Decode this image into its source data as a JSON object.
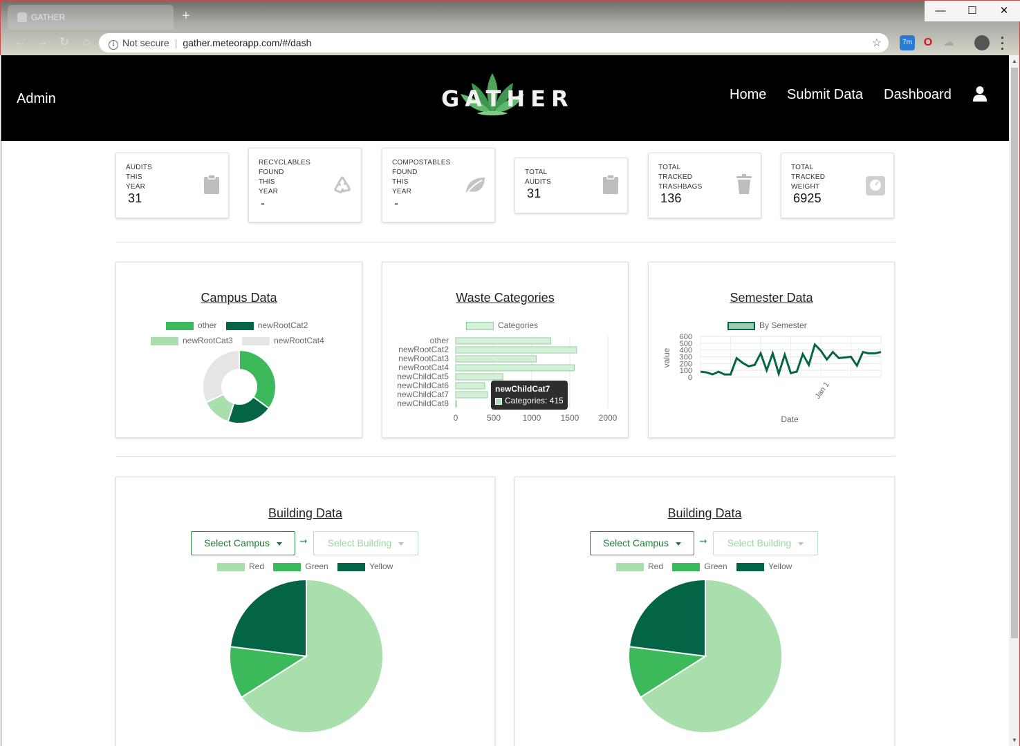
{
  "browser": {
    "tab_title": "GATHER",
    "security_label": "Not secure",
    "url": "gather.meteorapp.com/#/dash",
    "ext_badge": "7m"
  },
  "nav": {
    "user_label": "Admin",
    "logo_text": "GATHER",
    "links": [
      "Home",
      "Submit Data",
      "Dashboard"
    ]
  },
  "stats": [
    {
      "label": [
        "AUDITS",
        "THIS",
        "YEAR"
      ],
      "value": "31",
      "icon": "clipboard-icon"
    },
    {
      "label": [
        "RECYCLABLES",
        "FOUND",
        " THIS",
        "YEAR"
      ],
      "value": "-",
      "icon": "recycle-icon"
    },
    {
      "label": [
        "COMPOSTABLES",
        "FOUND",
        " THIS",
        "YEAR"
      ],
      "value": "-",
      "icon": "leaf-icon"
    },
    {
      "label": [
        "TOTAL",
        "AUDITS"
      ],
      "value": "31",
      "icon": "clipboard-icon"
    },
    {
      "label": [
        "TOTAL",
        "TRACKED",
        "TRASHBAGS"
      ],
      "value": "136",
      "icon": "trash-icon"
    },
    {
      "label": [
        "TOTAL",
        "TRACKED",
        "WEIGHT"
      ],
      "value": "6925",
      "icon": "scale-icon"
    }
  ],
  "colors": {
    "green": "#3cb95a",
    "dark_green": "#046546",
    "light_green": "#a9dfac",
    "grey": "#e5e5e5",
    "bar_fill": "#d5f0d9",
    "bar_stroke": "#8fd19c"
  },
  "campus": {
    "title": "Campus Data",
    "legend": [
      "other",
      "newRootCat2",
      "newRootCat3",
      "newRootCat4"
    ]
  },
  "waste": {
    "title": "Waste Categories",
    "legend": "Categories",
    "tooltip_title": "newChildCat7",
    "tooltip_value": "Categories: 415"
  },
  "semester": {
    "title": "Semester Data",
    "legend": "By Semester",
    "ylabel": "value",
    "xlabel": "Date",
    "x_tick": "Jan 1"
  },
  "building": {
    "title": "Building Data",
    "select_campus": "Select Campus",
    "select_building": "Select Building",
    "legend": [
      "Red",
      "Green",
      "Yellow"
    ]
  },
  "chart_data": [
    {
      "type": "pie",
      "title": "Campus Data",
      "categories": [
        "other",
        "newRootCat2",
        "newRootCat3",
        "newRootCat4"
      ],
      "values": [
        35,
        20,
        13,
        32
      ],
      "donut": true
    },
    {
      "type": "bar",
      "orientation": "horizontal",
      "title": "Waste Categories",
      "categories": [
        "other",
        "newRootCat2",
        "newRootCat3",
        "newRootCat4",
        "newChildCat5",
        "newChildCat6",
        "newChildCat7",
        "newChildCat8"
      ],
      "series": [
        {
          "name": "Categories",
          "values": [
            1250,
            1590,
            1060,
            1560,
            620,
            380,
            415,
            10
          ]
        }
      ],
      "xlim": [
        0,
        2000
      ],
      "xticks": [
        "0",
        "500",
        "1000",
        "1500",
        "2000"
      ]
    },
    {
      "type": "line",
      "title": "Semester Data",
      "series": [
        {
          "name": "By Semester",
          "values": [
            80,
            70,
            40,
            80,
            40,
            40,
            280,
            210,
            160,
            180,
            350,
            100,
            350,
            50,
            330,
            60,
            80,
            340,
            180,
            480,
            390,
            260,
            370,
            280,
            290,
            300,
            170,
            370,
            350,
            350,
            370
          ]
        }
      ],
      "ylim": [
        0,
        600
      ],
      "yticks": [
        "600",
        "500",
        "400",
        "300",
        "200",
        "100",
        "0"
      ],
      "xlabel": "Date",
      "ylabel": "value",
      "xticks": [
        "Jan 1"
      ],
      "grid": true
    },
    {
      "type": "pie",
      "title": "Building Data",
      "categories": [
        "Red",
        "Green",
        "Yellow"
      ],
      "values": [
        66,
        11,
        23
      ]
    },
    {
      "type": "pie",
      "title": "Building Data",
      "categories": [
        "Red",
        "Green",
        "Yellow"
      ],
      "values": [
        66,
        11,
        23
      ]
    }
  ]
}
